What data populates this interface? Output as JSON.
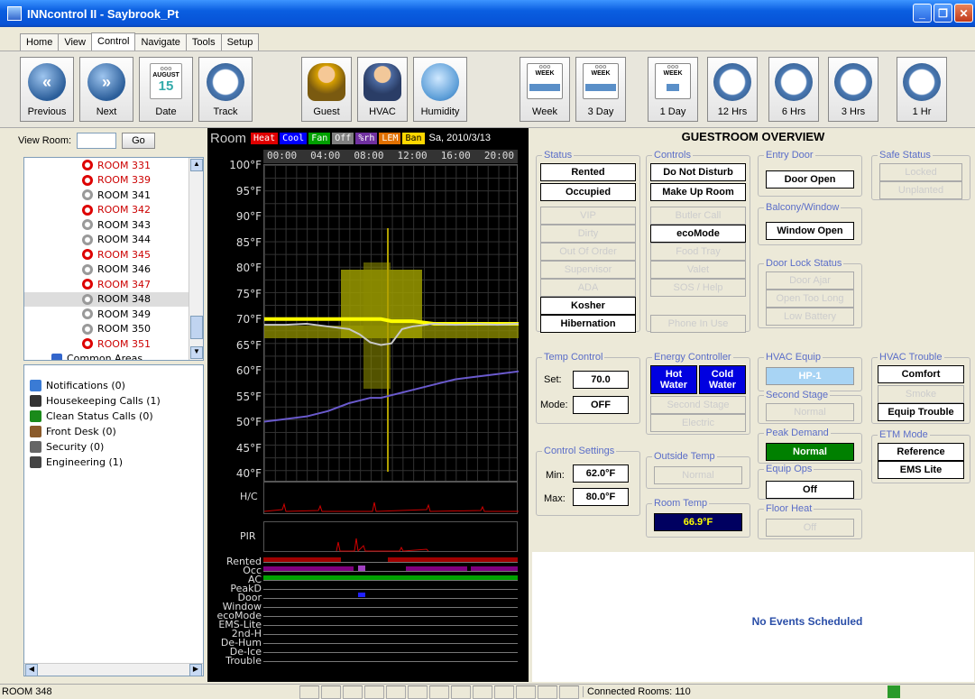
{
  "window": {
    "title": "INNcontrol II - Saybrook_Pt"
  },
  "menu": {
    "tabs": [
      "Home",
      "View",
      "Control",
      "Navigate",
      "Tools",
      "Setup"
    ],
    "active": "Control"
  },
  "toolbar": {
    "previous": "Previous",
    "next": "Next",
    "date": "Date",
    "track": "Track",
    "guest": "Guest",
    "hvac": "HVAC",
    "humidity": "Humidity",
    "week": "Week",
    "three_day": "3 Day",
    "one_day": "1 Day",
    "twelve_hrs": "12 Hrs",
    "six_hrs": "6 Hrs",
    "three_hrs": "3 Hrs",
    "one_hr": "1 Hr",
    "calendar_month": "AUGUST",
    "calendar_day": "15",
    "week_label": "WEEK"
  },
  "left": {
    "view_room_label": "View Room:",
    "go_label": "Go",
    "rooms": [
      {
        "name": "ROOM 331",
        "alert": true
      },
      {
        "name": "ROOM 339",
        "alert": true
      },
      {
        "name": "ROOM 341",
        "alert": false
      },
      {
        "name": "ROOM 342",
        "alert": true
      },
      {
        "name": "ROOM 343",
        "alert": false
      },
      {
        "name": "ROOM 344",
        "alert": false
      },
      {
        "name": "ROOM 345",
        "alert": true
      },
      {
        "name": "ROOM 346",
        "alert": false
      },
      {
        "name": "ROOM 347",
        "alert": true
      },
      {
        "name": "ROOM 348",
        "alert": false,
        "selected": true
      },
      {
        "name": "ROOM 349",
        "alert": false
      },
      {
        "name": "ROOM 350",
        "alert": false
      },
      {
        "name": "ROOM 351",
        "alert": true
      }
    ],
    "common_areas": "Common Areas",
    "calls": [
      {
        "label": "Notifications (0)",
        "icon": "globe-icon",
        "color": "#3a7bd5"
      },
      {
        "label": "Housekeeping Calls (1)",
        "icon": "housekeeper-icon",
        "color": "#333333"
      },
      {
        "label": "Clean Status Calls (0)",
        "icon": "clean-c-icon",
        "color": "#1a8a1a"
      },
      {
        "label": "Front Desk (0)",
        "icon": "front-desk-icon",
        "color": "#8a5a2a"
      },
      {
        "label": "Security (0)",
        "icon": "security-icon",
        "color": "#666666"
      },
      {
        "label": "Engineering (1)",
        "icon": "engineering-icon",
        "color": "#444444"
      }
    ]
  },
  "chart": {
    "title": "Room",
    "date": "Sa, 2010/3/13",
    "legend": [
      {
        "label": "Heat",
        "bg": "#e00000",
        "fg": "#ffffff"
      },
      {
        "label": "Cool",
        "bg": "#0000ff",
        "fg": "#ffffff"
      },
      {
        "label": "Fan",
        "bg": "#00a000",
        "fg": "#ffffff"
      },
      {
        "label": "Off",
        "bg": "#808080",
        "fg": "#ffffff"
      },
      {
        "label": "%rh",
        "bg": "#7030a0",
        "fg": "#ffffff"
      },
      {
        "label": "LEM",
        "bg": "#e07000",
        "fg": "#ffffff"
      },
      {
        "label": "Ban",
        "bg": "#ffd700",
        "fg": "#000000"
      }
    ],
    "times": [
      "00:00",
      "04:00",
      "08:00",
      "12:00",
      "16:00",
      "20:00"
    ],
    "y_ticks": [
      "100°F",
      "95°F",
      "90°F",
      "85°F",
      "80°F",
      "75°F",
      "70°F",
      "65°F",
      "60°F",
      "55°F",
      "50°F",
      "45°F",
      "40°F"
    ],
    "hc_label": "H/C",
    "pir_label": "PIR",
    "rows": [
      "Rented",
      "Occ",
      "AC",
      "PeakD",
      "Door",
      "Window",
      "ecoMode",
      "EMS-Lite",
      "2nd-H",
      "De-Hum",
      "De-Ice",
      "Trouble"
    ]
  },
  "chart_data": {
    "type": "line",
    "x_label": "",
    "ylim": [
      40,
      100
    ],
    "x": [
      0,
      2,
      4,
      6,
      8,
      9,
      10,
      11,
      12,
      13,
      14,
      16,
      18,
      20,
      22,
      24
    ],
    "series": [
      {
        "name": "",
        "color": "#ffff00",
        "values": [
          70.9,
          70.9,
          70.9,
          70.9,
          70.9,
          70.9,
          70.9,
          70.9,
          70.5,
          70.5,
          70.5,
          70.0,
          70.0,
          70.0,
          70.0,
          70.0
        ]
      },
      {
        "name": "",
        "color": "#c8c8c8",
        "values": [
          69.8,
          69.8,
          70.0,
          69.5,
          69.0,
          68.0,
          66.5,
          66.0,
          66.3,
          69.0,
          69.5,
          70.0,
          69.8,
          70.0,
          69.8,
          70.0
        ]
      },
      {
        "name": "",
        "color": "#6a5acd",
        "values": [
          51.5,
          52.0,
          52.5,
          53.5,
          55.0,
          55.5,
          56.0,
          56.0,
          56.5,
          57.0,
          57.5,
          58.5,
          59.5,
          60.0,
          60.5,
          61.0
        ]
      }
    ]
  },
  "overview": {
    "title": "GUESTROOM OVERVIEW",
    "status": {
      "label": "Status",
      "rented": "Rented",
      "occupied": "Occupied",
      "vip": "VIP",
      "dirty": "Dirty",
      "out_of_order": "Out Of Order",
      "supervisor": "Supervisor",
      "ada": "ADA",
      "kosher": "Kosher",
      "hibernation": "Hibernation"
    },
    "controls": {
      "label": "Controls",
      "dnd": "Do Not Disturb",
      "mur": "Make Up Room",
      "butler": "Butler Call",
      "eco": "ecoMode",
      "food": "Food Tray",
      "valet": "Valet",
      "sos": "SOS / Help",
      "phone": "Phone In Use"
    },
    "entry_door": {
      "label": "Entry Door",
      "value": "Door Open"
    },
    "balcony": {
      "label": "Balcony/Window",
      "value": "Window Open"
    },
    "door_lock": {
      "label": "Door Lock Status",
      "ajar": "Door Ajar",
      "open_long": "Open Too Long",
      "low_batt": "Low Battery"
    },
    "safe": {
      "label": "Safe Status",
      "locked": "Locked",
      "unplanted": "Unplanted"
    },
    "temp_control": {
      "label": "Temp Control",
      "set_label": "Set:",
      "set_value": "70.0",
      "mode_label": "Mode:",
      "mode_value": "OFF"
    },
    "energy": {
      "label": "Energy Controller",
      "hot": "Hot Water",
      "cold": "Cold Water",
      "second_stage": "Second Stage",
      "electric": "Electric"
    },
    "hvac_equip": {
      "label": "HVAC Equip",
      "value": "HP-1"
    },
    "second_stage": {
      "label": "Second Stage",
      "value": "Normal"
    },
    "peak": {
      "label": "Peak Demand",
      "value": "Normal"
    },
    "equip_ops": {
      "label": "Equip Ops",
      "value": "Off"
    },
    "floor_heat": {
      "label": "Floor Heat",
      "value": "Off"
    },
    "hvac_trouble": {
      "label": "HVAC Trouble",
      "comfort": "Comfort",
      "smoke": "Smoke",
      "equip": "Equip Trouble"
    },
    "etm": {
      "label": "ETM Mode",
      "reference": "Reference",
      "ems": "EMS Lite"
    },
    "control_settings": {
      "label": "Control Settings",
      "min_label": "Min:",
      "min_value": "62.0°F",
      "max_label": "Max:",
      "max_value": "80.0°F"
    },
    "outside": {
      "label": "Outside Temp",
      "value": "Normal"
    },
    "room_temp": {
      "label": "Room Temp",
      "value": "66.9°F"
    }
  },
  "events": {
    "message": "No Events Scheduled"
  },
  "status": {
    "room": "ROOM 348",
    "connected": "Connected Rooms: 110"
  }
}
